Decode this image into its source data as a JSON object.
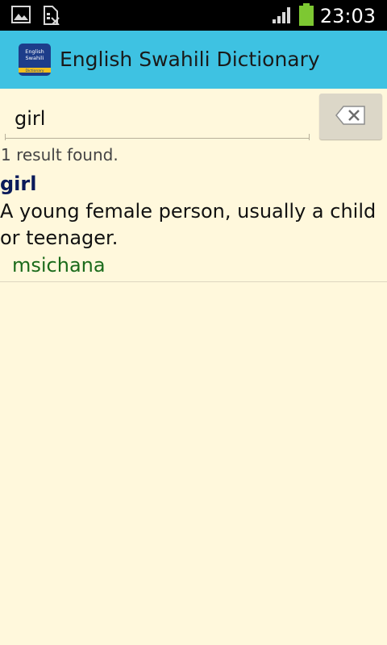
{
  "status_bar": {
    "time": "23:03",
    "icons": [
      "image-icon",
      "sim-card-off-icon",
      "signal-icon",
      "battery-icon"
    ]
  },
  "app_bar": {
    "title": "English Swahili Dictionary",
    "icon_text": [
      "English",
      "Swahili",
      "Dictionary"
    ]
  },
  "search": {
    "value": "girl",
    "placeholder": ""
  },
  "results": {
    "count_text": "1 result found.",
    "items": [
      {
        "word": "girl",
        "definition": "A young female person, usually a child or teenager.",
        "translation": "msichana"
      }
    ]
  },
  "colors": {
    "action_bar": "#3ec2e2",
    "background": "#fff8dc",
    "word": "#0a1a5a",
    "translation": "#1b6b1b"
  }
}
